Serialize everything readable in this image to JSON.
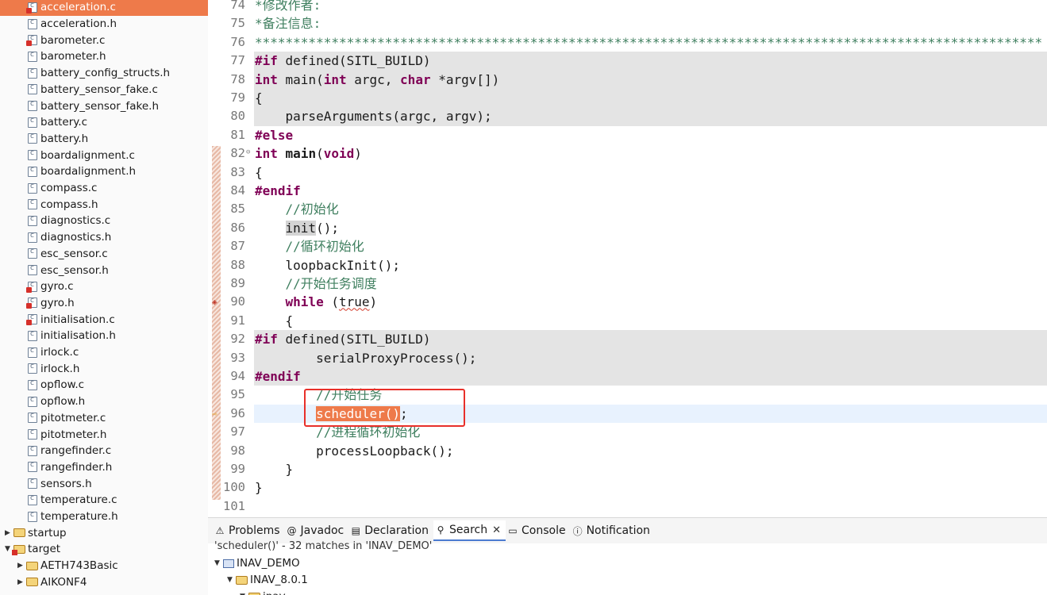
{
  "project_tree": {
    "files": [
      {
        "label": "acceleration.c",
        "selected": true,
        "error": true
      },
      {
        "label": "acceleration.h"
      },
      {
        "label": "barometer.c",
        "error": true
      },
      {
        "label": "barometer.h"
      },
      {
        "label": "battery_config_structs.h"
      },
      {
        "label": "battery_sensor_fake.c"
      },
      {
        "label": "battery_sensor_fake.h"
      },
      {
        "label": "battery.c"
      },
      {
        "label": "battery.h"
      },
      {
        "label": "boardalignment.c"
      },
      {
        "label": "boardalignment.h"
      },
      {
        "label": "compass.c"
      },
      {
        "label": "compass.h"
      },
      {
        "label": "diagnostics.c"
      },
      {
        "label": "diagnostics.h"
      },
      {
        "label": "esc_sensor.c"
      },
      {
        "label": "esc_sensor.h"
      },
      {
        "label": "gyro.c",
        "error": true
      },
      {
        "label": "gyro.h",
        "error": true
      },
      {
        "label": "initialisation.c",
        "error": true
      },
      {
        "label": "initialisation.h"
      },
      {
        "label": "irlock.c"
      },
      {
        "label": "irlock.h"
      },
      {
        "label": "opflow.c"
      },
      {
        "label": "opflow.h"
      },
      {
        "label": "pitotmeter.c"
      },
      {
        "label": "pitotmeter.h"
      },
      {
        "label": "rangefinder.c"
      },
      {
        "label": "rangefinder.h"
      },
      {
        "label": "sensors.h"
      },
      {
        "label": "temperature.c"
      },
      {
        "label": "temperature.h"
      }
    ],
    "folders": [
      {
        "label": "startup",
        "expanded": false,
        "indent": 0
      },
      {
        "label": "target",
        "expanded": true,
        "indent": 0,
        "error": true
      },
      {
        "label": "AETH743Basic",
        "expanded": false,
        "indent": 1
      },
      {
        "label": "AIKONF4",
        "expanded": false,
        "indent": 1
      }
    ]
  },
  "editor": {
    "lines": [
      {
        "n": "74",
        "segs": [
          {
            "t": "*修改作者:",
            "c": "cm"
          }
        ]
      },
      {
        "n": "75",
        "segs": [
          {
            "t": "*备注信息:",
            "c": "cm"
          }
        ]
      },
      {
        "n": "76",
        "segs": [
          {
            "t": "*******************************************************************************************************",
            "c": "cm"
          }
        ]
      },
      {
        "n": "77",
        "inactive": true,
        "segs": [
          {
            "t": "#if",
            "c": "kw"
          },
          {
            "t": " defined(SITL_BUILD)"
          }
        ]
      },
      {
        "n": "78",
        "inactive": true,
        "segs": [
          {
            "t": "int",
            "c": "kw"
          },
          {
            "t": " main("
          },
          {
            "t": "int",
            "c": "kw"
          },
          {
            "t": " argc, "
          },
          {
            "t": "char",
            "c": "kw"
          },
          {
            "t": " *argv[])"
          }
        ]
      },
      {
        "n": "79",
        "inactive": true,
        "segs": [
          {
            "t": "{"
          }
        ]
      },
      {
        "n": "80",
        "inactive": true,
        "segs": [
          {
            "t": "    parseArguments(argc, argv);"
          }
        ]
      },
      {
        "n": "81",
        "segs": [
          {
            "t": "#else",
            "c": "kw"
          }
        ]
      },
      {
        "n": "82",
        "fold": "⊖",
        "segs": [
          {
            "t": "int",
            "c": "kw"
          },
          {
            "t": " "
          },
          {
            "t": "main",
            "c": "fnb"
          },
          {
            "t": "("
          },
          {
            "t": "void",
            "c": "kw"
          },
          {
            "t": ")"
          }
        ]
      },
      {
        "n": "83",
        "segs": [
          {
            "t": "{"
          }
        ]
      },
      {
        "n": "84",
        "segs": [
          {
            "t": "#endif",
            "c": "kw"
          }
        ]
      },
      {
        "n": "85",
        "segs": [
          {
            "t": "    "
          },
          {
            "t": "//初始化",
            "c": "cm"
          }
        ]
      },
      {
        "n": "86",
        "segs": [
          {
            "t": "    "
          },
          {
            "t": "init",
            "c": "hl-init"
          },
          {
            "t": "();"
          }
        ]
      },
      {
        "n": "87",
        "segs": [
          {
            "t": "    "
          },
          {
            "t": "//循环初始化",
            "c": "cm"
          }
        ]
      },
      {
        "n": "88",
        "segs": [
          {
            "t": "    loopbackInit();"
          }
        ]
      },
      {
        "n": "89",
        "segs": [
          {
            "t": "    "
          },
          {
            "t": "//开始任务调度",
            "c": "cm"
          }
        ]
      },
      {
        "n": "90",
        "marker": "warn",
        "segs": [
          {
            "t": "    "
          },
          {
            "t": "while",
            "c": "kw"
          },
          {
            "t": " ("
          },
          {
            "t": "true",
            "c": "squiggle"
          },
          {
            "t": ")"
          }
        ]
      },
      {
        "n": "91",
        "segs": [
          {
            "t": "    {"
          }
        ]
      },
      {
        "n": "92",
        "inactive": true,
        "segs": [
          {
            "t": "#if",
            "c": "kw"
          },
          {
            "t": " defined(SITL_BUILD)"
          }
        ]
      },
      {
        "n": "93",
        "inactive": true,
        "segs": [
          {
            "t": "        serialProxyProcess();"
          }
        ]
      },
      {
        "n": "94",
        "inactive": true,
        "segs": [
          {
            "t": "#endif",
            "c": "kw"
          }
        ]
      },
      {
        "n": "95",
        "segs": [
          {
            "t": "        "
          },
          {
            "t": "//开始任务",
            "c": "cm"
          }
        ]
      },
      {
        "n": "96",
        "current": true,
        "marker": "arrow",
        "segs": [
          {
            "t": "        "
          },
          {
            "t": "scheduler()",
            "c": "hl-sched"
          },
          {
            "t": ";"
          }
        ]
      },
      {
        "n": "97",
        "segs": [
          {
            "t": "        "
          },
          {
            "t": "//进程循环初始化",
            "c": "cm"
          }
        ]
      },
      {
        "n": "98",
        "segs": [
          {
            "t": "        processLoopback();"
          }
        ]
      },
      {
        "n": "99",
        "segs": [
          {
            "t": "    }"
          }
        ]
      },
      {
        "n": "100",
        "segs": [
          {
            "t": "}"
          }
        ]
      },
      {
        "n": "101",
        "segs": []
      }
    ]
  },
  "panel": {
    "tabs": [
      {
        "icon": "problems-icon",
        "glyph": "⚠",
        "label": "Problems"
      },
      {
        "icon": "javadoc-icon",
        "glyph": "@",
        "label": "Javadoc"
      },
      {
        "icon": "declaration-icon",
        "glyph": "▤",
        "label": "Declaration"
      },
      {
        "icon": "search-icon",
        "glyph": "⚲",
        "label": "Search",
        "active": true,
        "closable": true
      },
      {
        "icon": "console-icon",
        "glyph": "▭",
        "label": "Console"
      },
      {
        "icon": "notification-icon",
        "glyph": "ⓘ",
        "label": "Notification"
      }
    ],
    "summary": "'scheduler()' - 32 matches in 'INAV_DEMO'",
    "results": [
      {
        "label": "INAV_DEMO",
        "kind": "project",
        "indent": 0
      },
      {
        "label": "INAV_8.0.1",
        "kind": "folder",
        "indent": 1
      },
      {
        "label": "inav",
        "kind": "folder",
        "indent": 2
      }
    ]
  },
  "colors": {
    "selection": "#ee7a4a",
    "keyword": "#7f0055",
    "comment": "#3f7f5f",
    "annotation_box": "#e8302a"
  }
}
